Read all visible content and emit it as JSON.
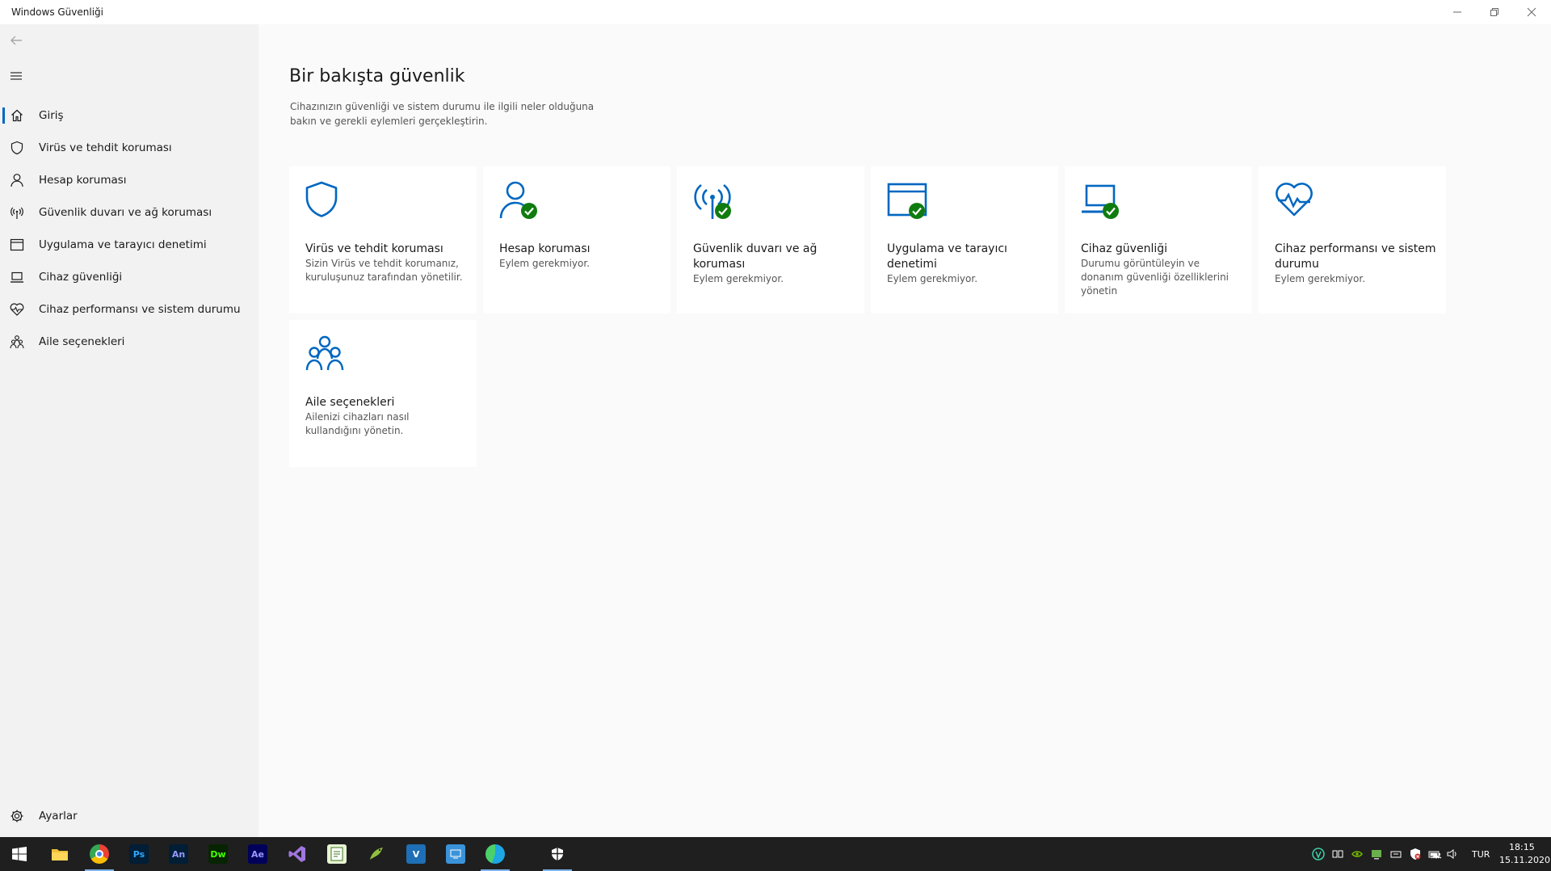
{
  "window": {
    "title": "Windows Güvenliği"
  },
  "sidebar": {
    "items": [
      {
        "label": "Giriş",
        "icon": "home-icon"
      },
      {
        "label": "Virüs ve tehdit koruması",
        "icon": "shield-icon"
      },
      {
        "label": "Hesap koruması",
        "icon": "person-icon"
      },
      {
        "label": "Güvenlik duvarı ve ağ koruması",
        "icon": "antenna-icon"
      },
      {
        "label": "Uygulama ve tarayıcı denetimi",
        "icon": "browser-window-icon"
      },
      {
        "label": "Cihaz güvenliği",
        "icon": "laptop-icon"
      },
      {
        "label": "Cihaz performansı ve sistem durumu",
        "icon": "heart-pulse-icon"
      },
      {
        "label": "Aile seçenekleri",
        "icon": "family-icon"
      }
    ],
    "active_index": 0,
    "settings_label": "Ayarlar"
  },
  "main": {
    "title": "Bir bakışta güvenlik",
    "description": "Cihazınızın güvenliği ve sistem durumu ile ilgili neler olduğuna bakın ve gerekli eylemleri gerçekleştirin.",
    "cards": [
      {
        "title": "Virüs ve tehdit koruması",
        "desc": "Sizin Virüs ve tehdit korumanız, kuruluşunuz tarafından yönetilir.",
        "icon": "shield-icon",
        "status": "none"
      },
      {
        "title": "Hesap koruması",
        "desc": "Eylem gerekmiyor.",
        "icon": "person-icon",
        "status": "ok"
      },
      {
        "title": "Güvenlik duvarı ve ağ koruması",
        "desc": "Eylem gerekmiyor.",
        "icon": "antenna-icon",
        "status": "ok"
      },
      {
        "title": "Uygulama ve tarayıcı denetimi",
        "desc": "Eylem gerekmiyor.",
        "icon": "browser-window-icon",
        "status": "ok"
      },
      {
        "title": "Cihaz güvenliği",
        "desc": "Durumu görüntüleyin ve donanım güvenliği özelliklerini yönetin",
        "icon": "laptop-icon",
        "status": "ok"
      },
      {
        "title": "Cihaz performansı ve sistem durumu",
        "desc": "Eylem gerekmiyor.",
        "icon": "heart-pulse-icon",
        "status": "none"
      },
      {
        "title": "Aile seçenekleri",
        "desc": "Ailenizi cihazları nasıl kullandığını yönetin.",
        "icon": "family-icon",
        "status": "none"
      }
    ]
  },
  "colors": {
    "accent": "#0067c0",
    "ok_green": "#107c10",
    "taskbar": "#1f1f1f"
  },
  "taskbar": {
    "apps": [
      {
        "name": "file-explorer-icon",
        "text": "",
        "bg": "#f0c03a",
        "fg": "#7a5400"
      },
      {
        "name": "chrome-icon",
        "text": "",
        "bg": "#ffffff",
        "fg": "#000000"
      },
      {
        "name": "photoshop-icon",
        "text": "Ps",
        "bg": "#001e36",
        "fg": "#31a8ff"
      },
      {
        "name": "animate-icon",
        "text": "An",
        "bg": "#001e36",
        "fg": "#9999ff"
      },
      {
        "name": "dreamweaver-icon",
        "text": "Dw",
        "bg": "#072401",
        "fg": "#46ff00"
      },
      {
        "name": "after-effects-icon",
        "text": "Ae",
        "bg": "#00005b",
        "fg": "#9999ff"
      },
      {
        "name": "visual-studio-icon",
        "text": "",
        "bg": "#1f1f1f",
        "fg": "#a176e0"
      },
      {
        "name": "notepad-plus-icon",
        "text": "",
        "bg": "#e8f3d4",
        "fg": "#3b7a1c"
      },
      {
        "name": "gecko-app-icon",
        "text": "",
        "bg": "#1f1f1f",
        "fg": "#8fbf3f"
      },
      {
        "name": "v-app-icon",
        "text": "V",
        "bg": "#1e6fb5",
        "fg": "#ffffff"
      },
      {
        "name": "remote-app-icon",
        "text": "",
        "bg": "#3a93d9",
        "fg": "#ffffff"
      },
      {
        "name": "edge-icon",
        "text": "",
        "bg": "#1f1f1f",
        "fg": "#1ea7e4"
      },
      {
        "name": "defender-icon",
        "text": "",
        "bg": "#1f1f1f",
        "fg": "#ffffff"
      }
    ],
    "language": "TUR",
    "time": "18:15",
    "date": "15.11.2020"
  }
}
